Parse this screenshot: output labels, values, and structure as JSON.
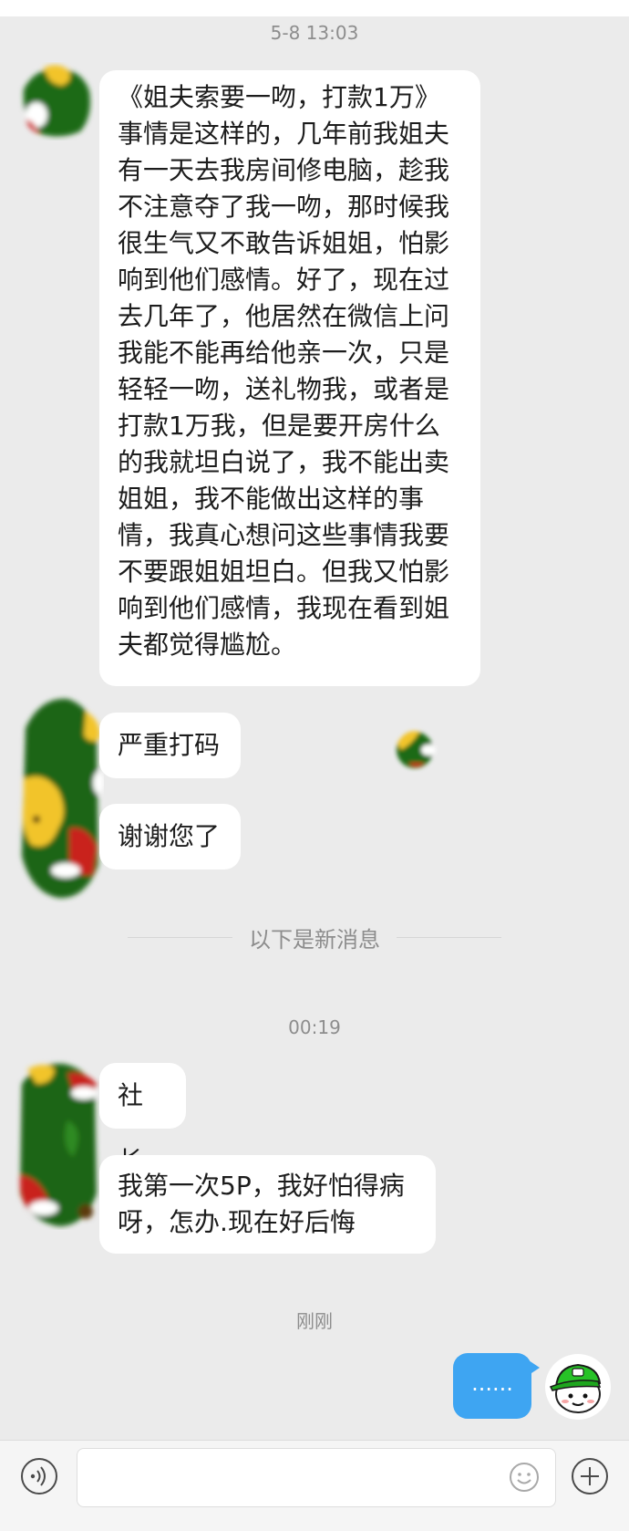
{
  "timestamps": {
    "first": "5-8 13:03",
    "second": "00:19",
    "third": "刚刚"
  },
  "messages": {
    "long_story": [
      "《姐夫索要一吻，打款1万》",
      "事情是这样的，几年前我姐夫",
      "有一天去我房间修电脑，趁我",
      "不注意夺了我一吻，那时候我",
      "很生气又不敢告诉姐姐，怕影",
      "响到他们感情。好了，现在过",
      "去几年了，他居然在微信上问",
      "我能不能再给他亲一次，只是",
      "轻轻一吻，送礼物我，或者是",
      "打款1万我，但是要开房什么",
      "的我就坦白说了，我不能出卖",
      "姐姐，我不能做出这样的事",
      "情，我真心想问这些事情我要",
      "不要跟姐姐坦白。但我又怕影",
      "响到他们感情，我现在看到姐",
      "夫都觉得尴尬。"
    ],
    "heavy_mosaic": "严重打码",
    "thanks": "谢谢您了",
    "shezhang": "社长",
    "fivep": [
      "我第一次5P，我好怕得病",
      "呀，怎办.现在好后悔"
    ],
    "outgoing": "......"
  },
  "new_messages_divider": "以下是新消息",
  "icons": {
    "voice": "voice-icon",
    "emoji": "emoji-icon",
    "plus": "plus-icon"
  },
  "colors": {
    "background": "#ebebeb",
    "outgoing_bubble": "#3ea5f2",
    "incoming_bubble": "#ffffff"
  }
}
